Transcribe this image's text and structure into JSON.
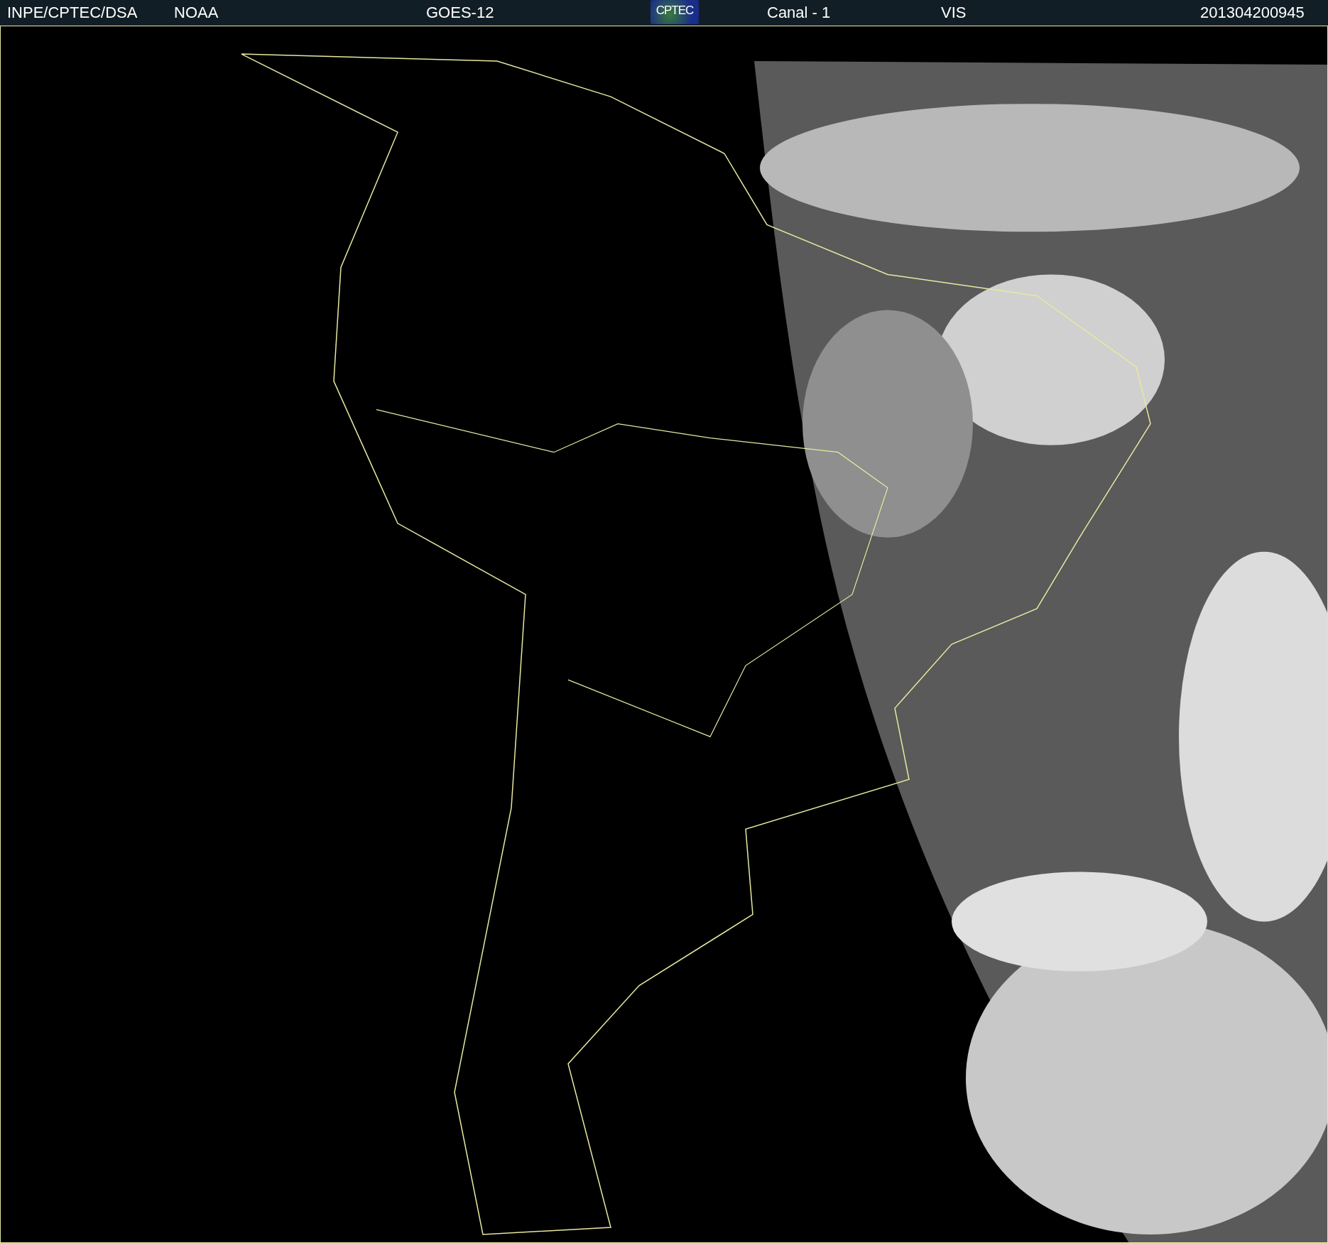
{
  "header": {
    "items": [
      {
        "kind": "text",
        "text": "INPE/CPTEC/DSA"
      },
      {
        "kind": "text",
        "text": "NOAA"
      },
      {
        "kind": "text",
        "text": "GOES-12"
      },
      {
        "kind": "logo",
        "text": "CPTEC"
      },
      {
        "kind": "text",
        "text": "Canal - 1"
      },
      {
        "kind": "text",
        "text": "VIS"
      },
      {
        "kind": "text",
        "text": "201304200945"
      }
    ]
  }
}
